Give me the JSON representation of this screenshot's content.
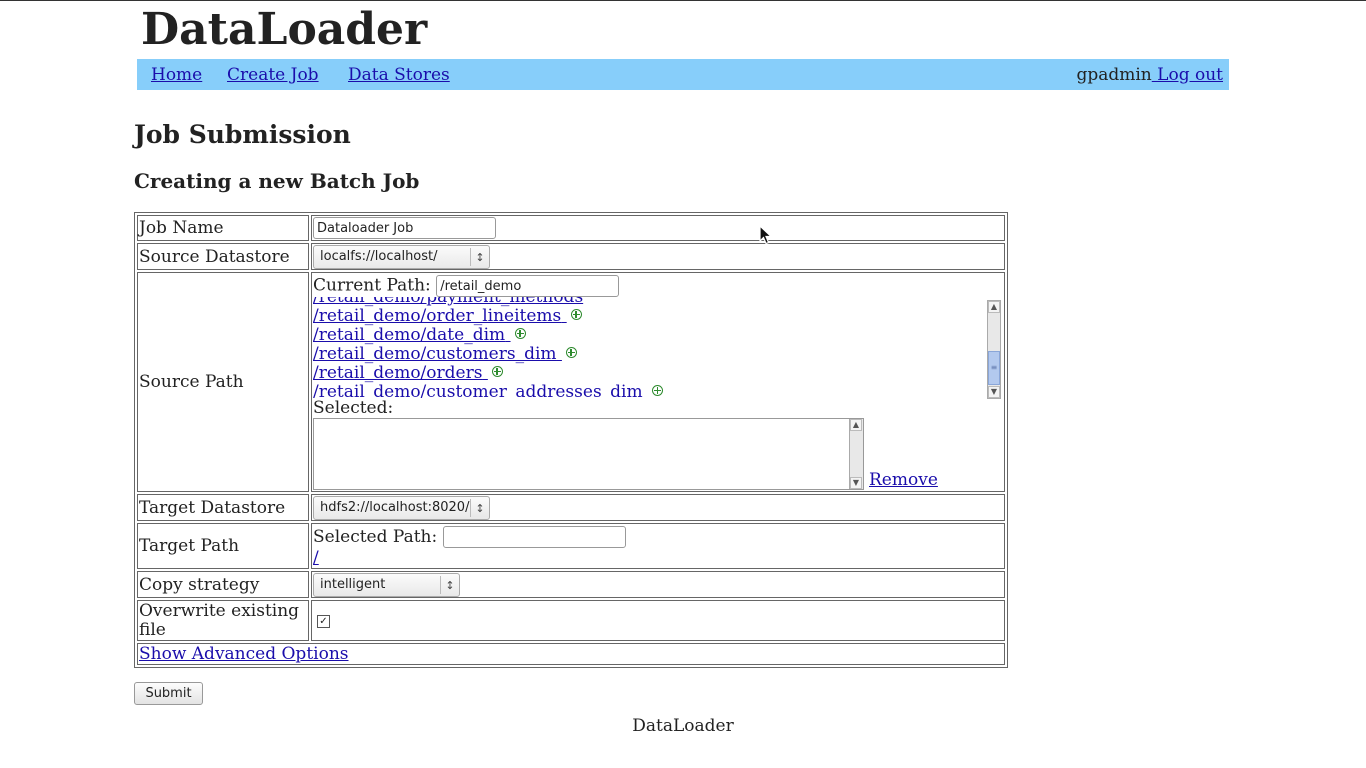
{
  "app_title": "DataLoader",
  "nav": {
    "items": [
      "Home",
      "Create Job",
      "Data Stores"
    ],
    "username": "gpadmin",
    "logout_label": " Log out"
  },
  "page": {
    "title": "Job Submission",
    "subtitle": "Creating a new Batch Job"
  },
  "form": {
    "job_name": {
      "label": "Job Name",
      "value": "Dataloader Job"
    },
    "source_datastore": {
      "label": "Source Datastore",
      "selected": "localfs://localhost/"
    },
    "source_path": {
      "label": "Source Path",
      "current_path_label": "Current Path:",
      "current_path_value": "/retail_demo",
      "partial_item": "/retail_demo/payment_methods",
      "items": [
        "/retail_demo/order_lineitems",
        "/retail_demo/date_dim",
        "/retail_demo/customers_dim",
        "/retail_demo/orders",
        "/retail_demo/customer_addresses_dim"
      ],
      "selected_label": "Selected:",
      "remove_label": "Remove"
    },
    "target_datastore": {
      "label": "Target Datastore",
      "selected": "hdfs2://localhost:8020/"
    },
    "target_path": {
      "label": "Target Path",
      "selected_path_label": "Selected Path:",
      "selected_path_value": "",
      "root_link": "/"
    },
    "copy_strategy": {
      "label": "Copy strategy",
      "selected": "intelligent"
    },
    "overwrite": {
      "label": "Overwrite existing file",
      "checked": true,
      "check_glyph": "✓"
    },
    "advanced_label": "Show Advanced Options",
    "submit_label": "Submit"
  },
  "footer": "DataLoader",
  "colors": {
    "navbar": "#87cefa",
    "link": "#1a0dab",
    "add_icon": "#2e8b2e"
  },
  "icons": [
    "add-circle-icon",
    "mouse-cursor-icon",
    "select-arrow-icon",
    "checkmark-icon"
  ]
}
